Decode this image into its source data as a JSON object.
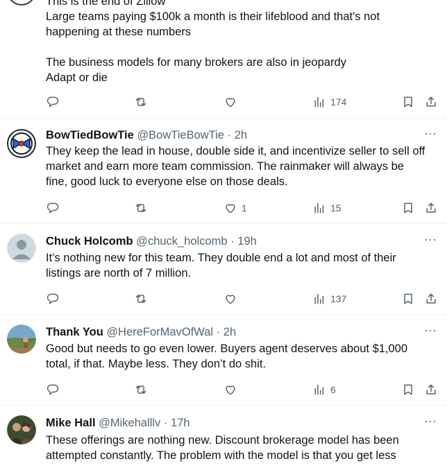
{
  "tweets": [
    {
      "partial_top": true,
      "top_line": "This is the end of Zillow",
      "lines": [
        "Large teams paying $100k a month is their lifeblood and that's not",
        "happening at these numbers",
        "",
        "The business models for many brokers are also in jeopardy",
        "Adapt or die"
      ],
      "likes": "",
      "views": "174"
    },
    {
      "name": "BowTiedBowTie",
      "handle": "@BowTieBowTie",
      "time": "2h",
      "avatar": "bowtie",
      "lines": [
        "They keep the lead in house, double side it, and incentivize seller to sell off",
        "market and earn more team commission. The rainmaker will always be",
        "fine, good luck to everyone else on those deals."
      ],
      "likes": "1",
      "views": "15"
    },
    {
      "name": "Chuck Holcomb",
      "handle": "@chuck_holcomb",
      "time": "19h",
      "avatar": "default",
      "lines": [
        "It’s nothing new for this team. They double end a lot and most of their",
        "listings are north of 7 million."
      ],
      "likes": "",
      "views": "137"
    },
    {
      "name": "Thank You",
      "handle": "@HereForMavOfWal",
      "time": "2h",
      "avatar": "landscape",
      "lines": [
        "Good but needs to go even lower. Buyers agent deserves about $1,000",
        "total, if that. Maybe less. They don’t do shit."
      ],
      "likes": "",
      "views": "6"
    },
    {
      "name": "Mike Hall",
      "handle": "@Mikehalllv",
      "time": "17h",
      "avatar": "people",
      "lines": [
        "These offerings are nothing new. Discount brokerage model has been",
        "attempted constantly. The problem with the model is that you get less"
      ],
      "likes": "",
      "views": ""
    }
  ],
  "separator": "·",
  "more_glyph": "···",
  "colors": {
    "text": "#0f1419",
    "meta": "#536471",
    "divider": "#eff3f4"
  }
}
